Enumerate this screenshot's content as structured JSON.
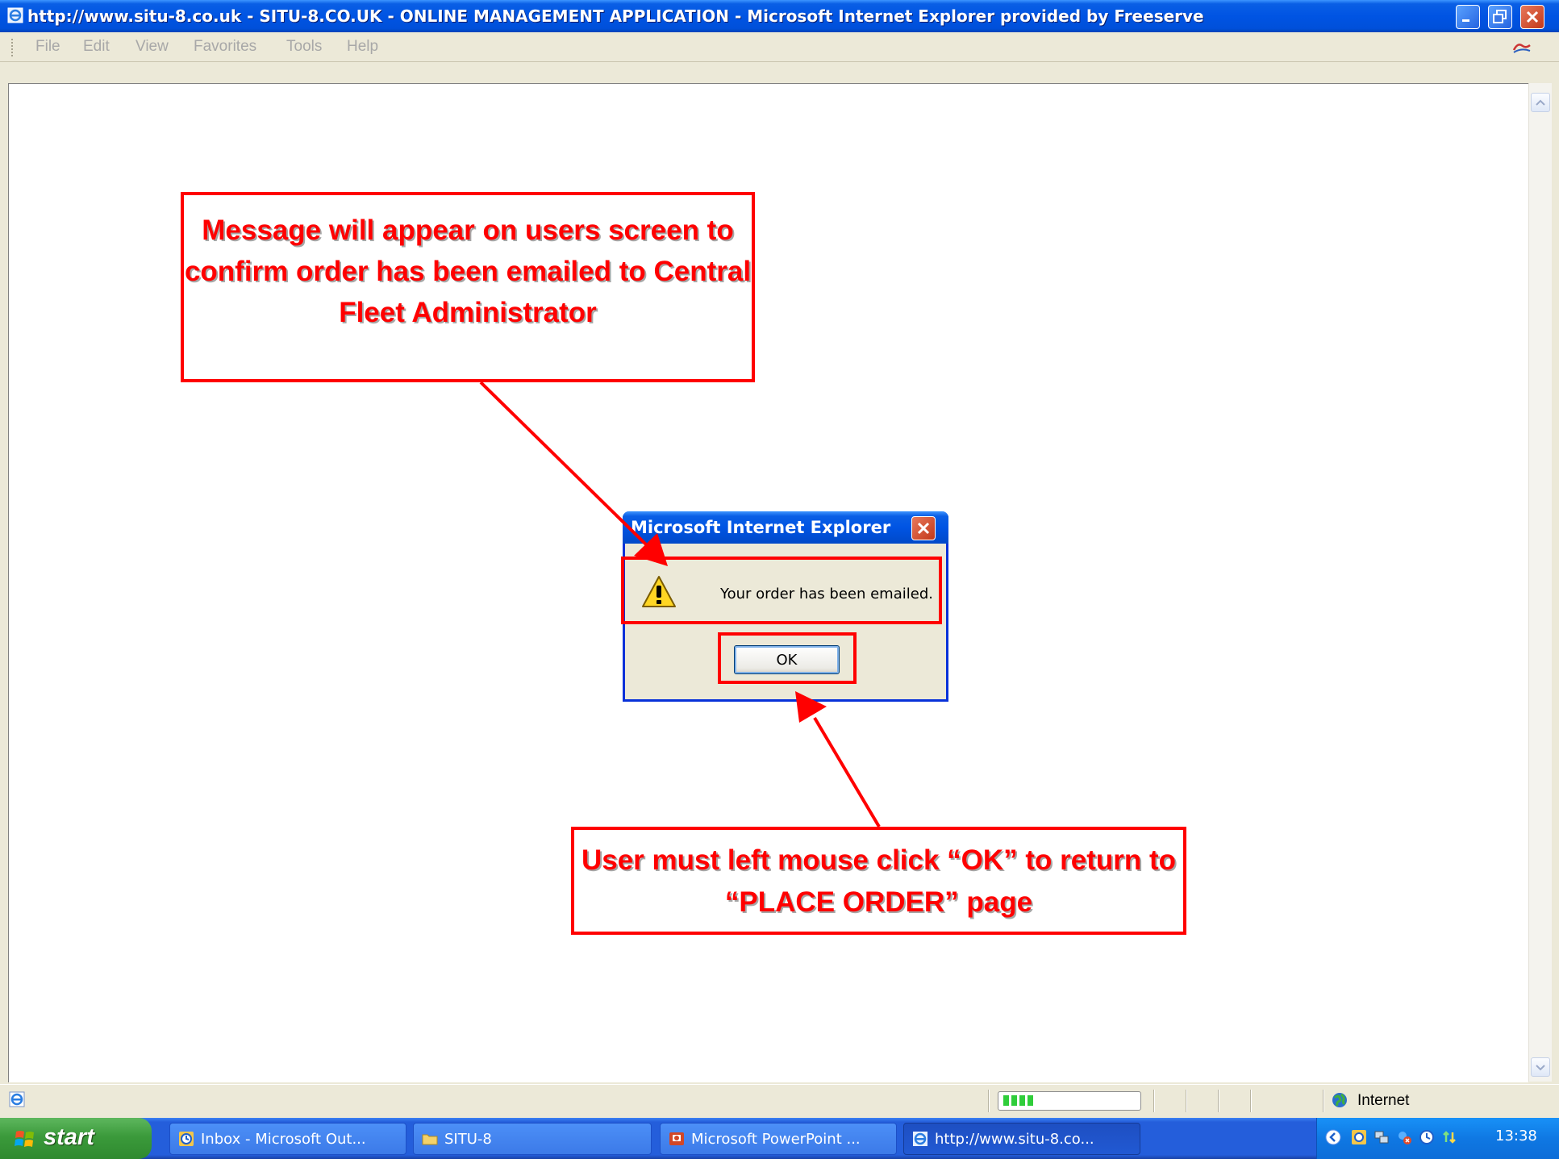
{
  "window": {
    "title": "http://www.situ-8.co.uk - SITU-8.CO.UK - ONLINE MANAGEMENT APPLICATION - Microsoft Internet Explorer provided by Freeserve",
    "icon": "ie-page-icon",
    "controls": [
      "minimize-icon",
      "maximize-icon",
      "close-icon"
    ]
  },
  "menubar": {
    "items": [
      "File",
      "Edit",
      "View",
      "Favorites",
      "Tools",
      "Help"
    ],
    "color": "#a8a8a8"
  },
  "dialog": {
    "title": "Microsoft Internet Explorer",
    "message": "Your order has been emailed.",
    "ok_label": "OK",
    "icon": "warning-icon"
  },
  "annotations": {
    "top_callout": "Message will appear on users screen to confirm order has been emailed to Central Fleet Administrator",
    "bottom_callout": "User must left mouse click “OK” to return to “PLACE ORDER” page",
    "color": "#ff0000"
  },
  "statusbar": {
    "zone_label": "Internet",
    "zone_icon": "globe-icon",
    "progress_segments": 4
  },
  "taskbar": {
    "start_label": "start",
    "buttons": [
      {
        "label": "Inbox - Microsoft Out...",
        "icon": "outlook-icon"
      },
      {
        "label": "SITU-8",
        "icon": "folder-icon"
      },
      {
        "label": "Microsoft PowerPoint ...",
        "icon": "powerpoint-icon"
      },
      {
        "label": "http://www.situ-8.co...",
        "icon": "ie-page-icon",
        "active": true
      }
    ],
    "clock": "13:38"
  },
  "colors": {
    "title_blue": "#0054e3",
    "annotation_red": "#ff0000",
    "window_face": "#ece9d8"
  }
}
